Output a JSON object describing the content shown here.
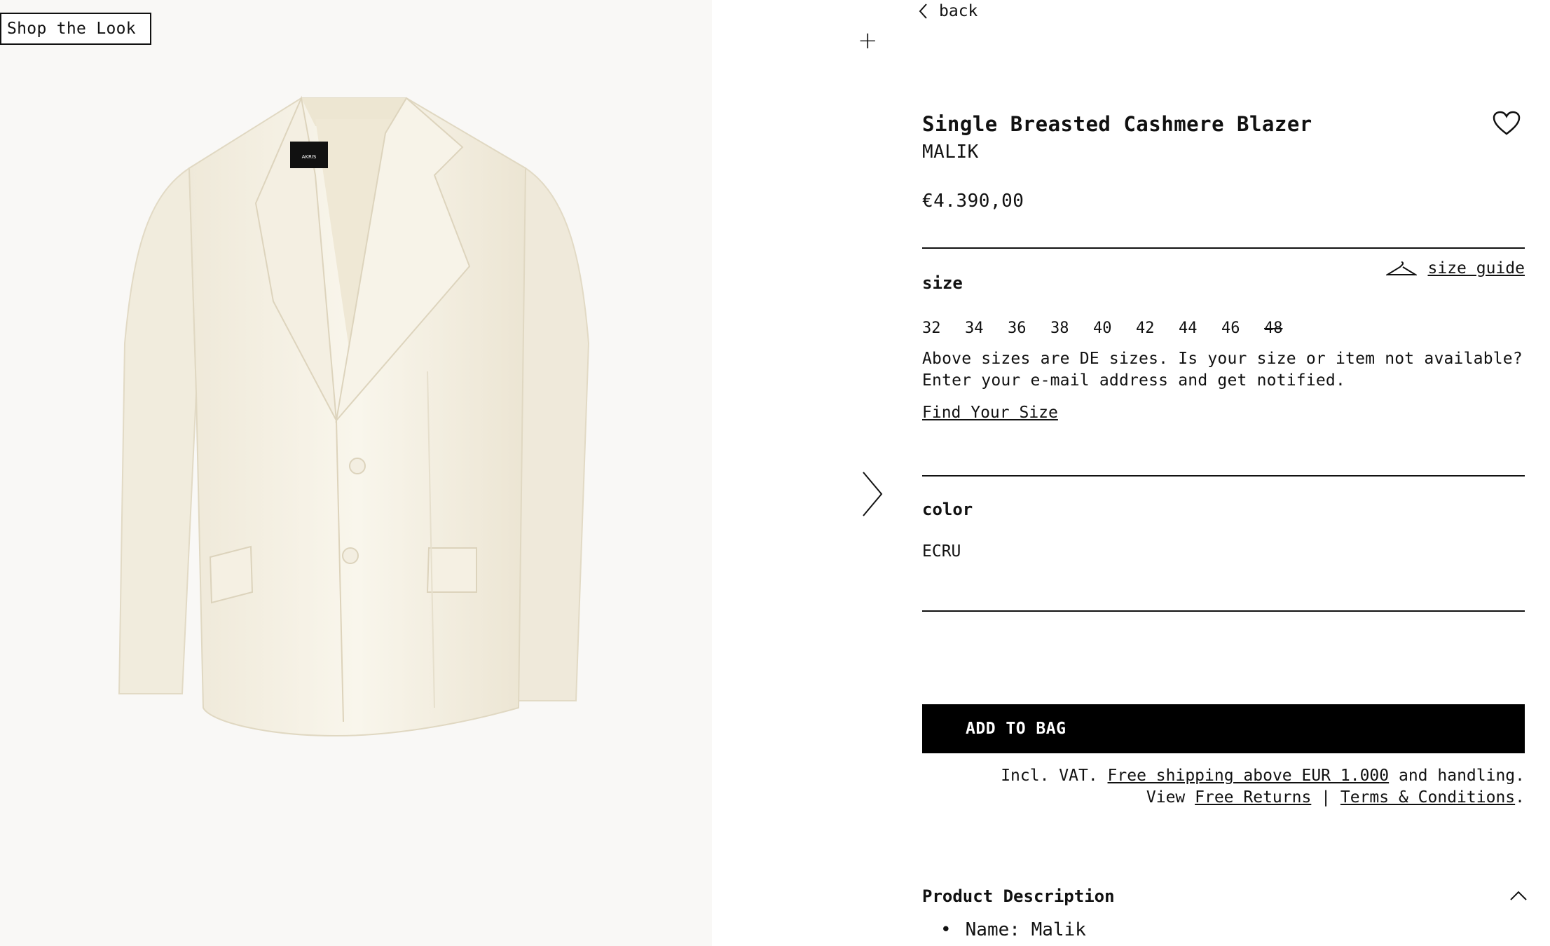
{
  "image_panel": {
    "shop_the_look": "Shop the Look",
    "label_text": "AKRIS"
  },
  "nav": {
    "back_label": "back"
  },
  "product": {
    "title": "Single Breasted Cashmere Blazer",
    "brand": "MALIK",
    "price": "€4.390,00"
  },
  "size_section": {
    "label": "size",
    "size_guide_label": "size guide",
    "sizes": [
      {
        "value": "32",
        "available": true
      },
      {
        "value": "34",
        "available": true
      },
      {
        "value": "36",
        "available": true
      },
      {
        "value": "38",
        "available": true
      },
      {
        "value": "40",
        "available": true
      },
      {
        "value": "42",
        "available": true
      },
      {
        "value": "44",
        "available": true
      },
      {
        "value": "46",
        "available": true
      },
      {
        "value": "48",
        "available": false
      }
    ],
    "note": "Above sizes are DE sizes. Is your size or item not available? Enter your e-mail address and get notified.",
    "find_size_link": "Find Your Size"
  },
  "color_section": {
    "label": "color",
    "value": "ECRU"
  },
  "cart": {
    "add_to_bag": "ADD TO BAG",
    "vat_prefix": "Incl. VAT.",
    "free_shipping_link": "Free shipping above EUR 1.000",
    "vat_suffix": "and handling.",
    "view_prefix": "View",
    "free_returns_link": "Free Returns",
    "separator": "|",
    "terms_link": "Terms & Conditions",
    "period": "."
  },
  "description": {
    "title": "Product Description",
    "items": [
      "Name: Malik"
    ]
  },
  "icons": {
    "plus": "plus-icon",
    "next": "chevron-right-icon",
    "back": "chevron-left-icon",
    "favorite": "heart-icon",
    "size_guide": "hanger-icon",
    "collapse": "chevron-up-icon"
  },
  "colors": {
    "button_bg": "#000000",
    "image_bg": "#f9f8f6",
    "blazer": "#f6f2e6"
  }
}
